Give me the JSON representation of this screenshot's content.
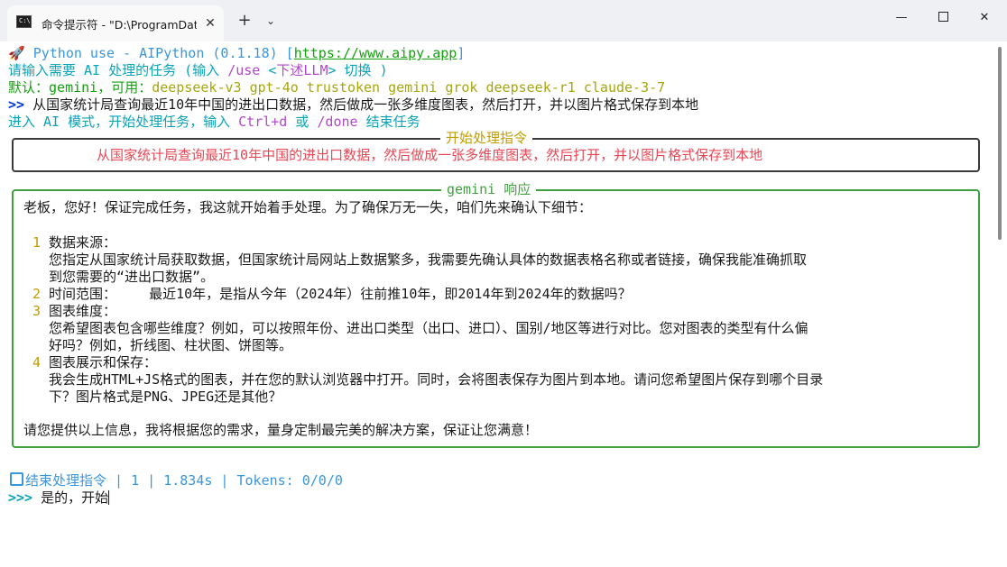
{
  "window": {
    "tab_title": "命令提示符 - \"D:\\ProgramData",
    "tab_icon": "cmd-icon",
    "close_tab": "✕",
    "new_tab": "+",
    "dropdown": "⌄",
    "minimize": "—",
    "close": "✕"
  },
  "header": {
    "rocket": "🚀",
    "app_line": " Python use - AIPython (0.1.18) [",
    "url": "https://www.aipy.app",
    "url_close": "]",
    "prompt_line_a": "请输入需要 AI 处理的任务 (输入 ",
    "prompt_line_use": "/use",
    "prompt_line_b": " <",
    "prompt_line_c": "下述LLM",
    "prompt_line_d": "> 切换 )",
    "default_label": "默认：",
    "default_model": "gemini",
    "available_label": "，可用：",
    "models": "deepseek-v3 gpt-4o trustoken gemini grok deepseek-r1 claude-3-7",
    "input_prompt": ">>",
    "input_text": " 从国家统计局查询最近10年中国的进出口数据，然后做成一张多维度图表，然后打开，并以图片格式保存到本地",
    "ai_mode_a": "进入 AI 模式，开始处理任务，输入 ",
    "ai_mode_ctrl": "Ctrl+d",
    "ai_mode_b": " 或 ",
    "ai_mode_done": "/done",
    "ai_mode_c": " 结束任务"
  },
  "instruction_panel": {
    "title": "开始处理指令",
    "text": "从国家统计局查询最近10年中国的进出口数据，然后做成一张多维度图表，然后打开，并以图片格式保存到本地"
  },
  "response_panel": {
    "title": "gemini 响应",
    "greeting": "老板，您好！保证完成任务，我这就开始着手处理。为了确保万无一失，咱们先来确认下细节：",
    "items": [
      {
        "num": "1",
        "title": "数据来源：",
        "lines": [
          "您指定从国家统计局获取数据，但国家统计局网站上数据繁多，我需要先确认具体的数据表格名称或者链接，确保我能准确抓取",
          "到您需要的“进出口数据”。"
        ]
      },
      {
        "num": "2",
        "title": "时间范围：    最近10年，是指从今年（2024年）往前推10年，即2014年到2024年的数据吗？",
        "lines": []
      },
      {
        "num": "3",
        "title": "图表维度：",
        "lines": [
          "您希望图表包含哪些维度？例如，可以按照年份、进出口类型（出口、进口）、国别/地区等进行对比。您对图表的类型有什么偏",
          "好吗？例如，折线图、柱状图、饼图等。"
        ]
      },
      {
        "num": "4",
        "title": "图表展示和保存：",
        "lines": [
          "我会生成HTML+JS格式的图表，并在您的默认浏览器中打开。同时，会将图表保存为图片到本地。请问您希望图片保存到哪个目录",
          "下？图片格式是PNG、JPEG还是其他？"
        ]
      }
    ],
    "closing": "请您提供以上信息，我将根据您的需求，量身定制最完美的解决方案，保证让您满意！"
  },
  "status": {
    "icon": "stop-square-icon",
    "text": "结束处理指令 | 1 | 1.834s | Tokens: 0/0/0"
  },
  "input": {
    "prompt": ">>>",
    "text": " 是的，开始"
  },
  "colors": {
    "instruction_border": "#3a3a3a",
    "instruction_title": "#c19c00",
    "instruction_text": "#e74856",
    "response_border": "#40a040",
    "response_title": "#40a040"
  }
}
